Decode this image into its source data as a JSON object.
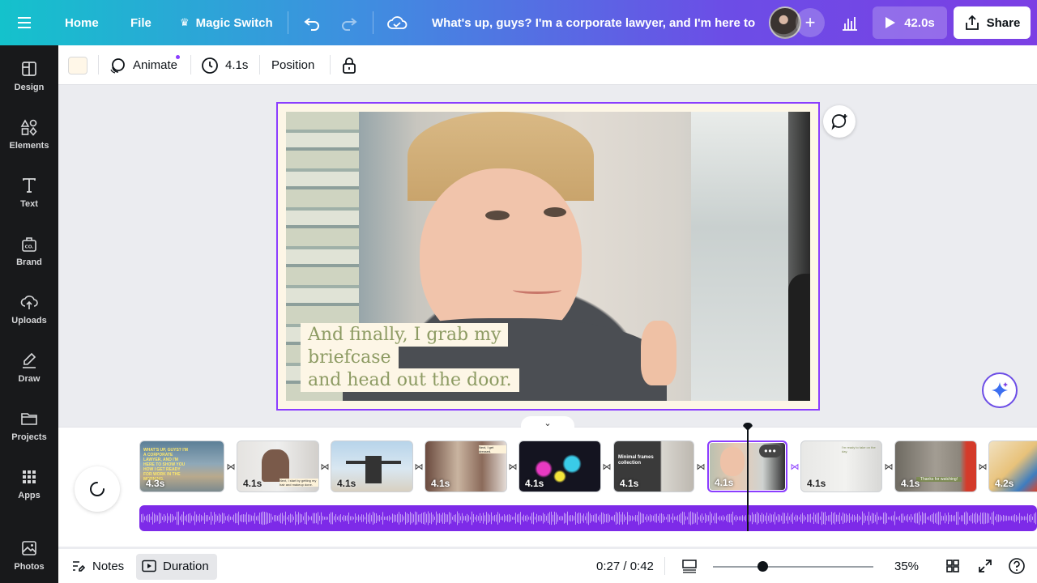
{
  "topbar": {
    "home": "Home",
    "file": "File",
    "magic_switch": "Magic Switch",
    "doc_title": "What's up, guys? I'm a corporate lawyer, and I'm here to ...",
    "play_duration": "42.0s",
    "share": "Share"
  },
  "sidebar": {
    "items": [
      {
        "label": "Design",
        "icon": "design-icon"
      },
      {
        "label": "Elements",
        "icon": "elements-icon"
      },
      {
        "label": "Text",
        "icon": "text-icon"
      },
      {
        "label": "Brand",
        "icon": "brand-icon"
      },
      {
        "label": "Uploads",
        "icon": "upload-icon"
      },
      {
        "label": "Draw",
        "icon": "draw-icon"
      },
      {
        "label": "Projects",
        "icon": "folder-icon"
      },
      {
        "label": "Apps",
        "icon": "apps-icon"
      },
      {
        "label": "Photos",
        "icon": "photos-icon"
      }
    ]
  },
  "toolbar": {
    "swatch_color": "#fff7e8",
    "animate": "Animate",
    "duration": "4.1s",
    "position": "Position"
  },
  "canvas": {
    "caption": "And finally, I grab my briefcase and head out the door.",
    "caption_lines": [
      "And finally, I grab my briefcase",
      "and head out the door."
    ],
    "caption_color": "#8d9b63"
  },
  "timeline": {
    "clips": [
      {
        "duration": "4.3s",
        "thumb_text": "WHAT'S UP, GUYS? I'M A CORPORATE LAWYER, AND I'M HERE TO SHOW YOU HOW I GET READY FOR WORK IN THE MORNING."
      },
      {
        "duration": "4.1s",
        "thumb_text": "Next, I start by getting my hair and makeup done."
      },
      {
        "duration": "4.1s",
        "thumb_text": ""
      },
      {
        "duration": "4.1s",
        "thumb_text": "Next, I get dressed."
      },
      {
        "duration": "4.1s",
        "thumb_text": ""
      },
      {
        "duration": "4.1s",
        "thumb_text": "Minimal frames collection"
      },
      {
        "duration": "4.1s",
        "thumb_text": ""
      },
      {
        "duration": "4.1s",
        "thumb_text": "I'm ready to take on the day."
      },
      {
        "duration": "4.1s",
        "thumb_text": "Thanks for watching!"
      },
      {
        "duration": "4.2s",
        "thumb_text": ""
      }
    ],
    "accent": "#8b3dff"
  },
  "footer": {
    "notes": "Notes",
    "duration": "Duration",
    "time": "0:27 / 0:42",
    "zoom": "35%",
    "zoom_level": 0.31
  }
}
